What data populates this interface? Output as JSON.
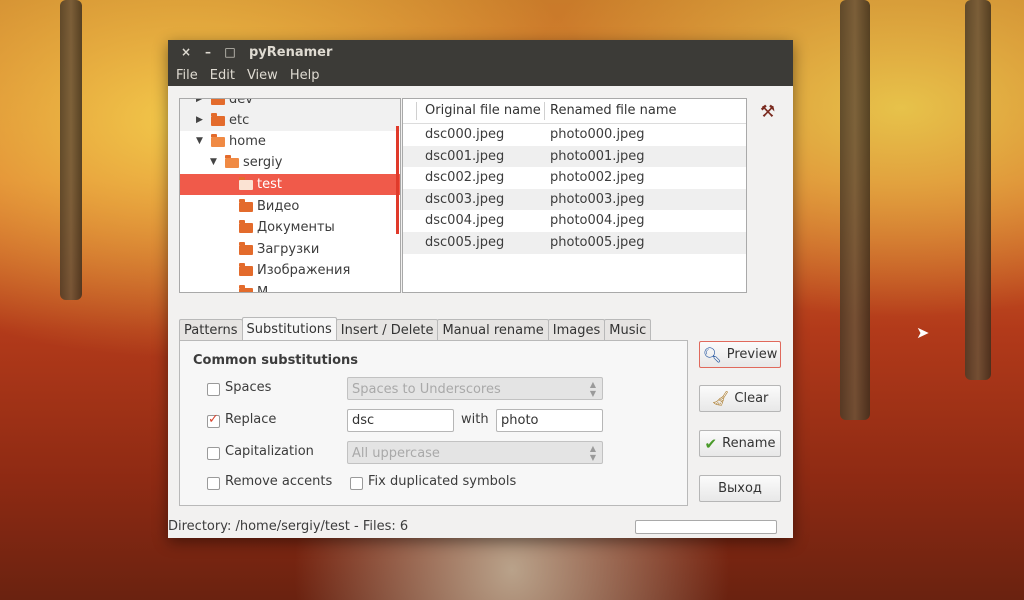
{
  "window": {
    "title": "pyRenamer"
  },
  "titlebar": {
    "close": "×",
    "minimize": "–",
    "maximize": "□"
  },
  "menu": [
    "File",
    "Edit",
    "View",
    "Help"
  ],
  "tree": [
    {
      "label": "dev",
      "indent": 0,
      "expanded": false
    },
    {
      "label": "etc",
      "indent": 0,
      "expanded": false
    },
    {
      "label": "home",
      "indent": 0,
      "expanded": true
    },
    {
      "label": "sergiy",
      "indent": 1,
      "expanded": true
    },
    {
      "label": "test",
      "indent": 2,
      "selected": true
    },
    {
      "label": "Видео",
      "indent": 2
    },
    {
      "label": "Документы",
      "indent": 2
    },
    {
      "label": "Загрузки",
      "indent": 2
    },
    {
      "label": "Изображения",
      "indent": 2
    },
    {
      "label": "М",
      "indent": 2
    }
  ],
  "files": {
    "headers": [
      "Original file name",
      "Renamed file name"
    ],
    "rows": [
      [
        "dsc000.jpeg",
        "photo000.jpeg"
      ],
      [
        "dsc001.jpeg",
        "photo001.jpeg"
      ],
      [
        "dsc002.jpeg",
        "photo002.jpeg"
      ],
      [
        "dsc003.jpeg",
        "photo003.jpeg"
      ],
      [
        "dsc004.jpeg",
        "photo004.jpeg"
      ],
      [
        "dsc005.jpeg",
        "photo005.jpeg"
      ]
    ]
  },
  "tabs": [
    "Patterns",
    "Substitutions",
    "Insert / Delete",
    "Manual rename",
    "Images",
    "Music"
  ],
  "active_tab": "Substitutions",
  "substitutions": {
    "title": "Common substitutions",
    "spaces": {
      "label": "Spaces",
      "checked": false,
      "value": "Spaces to Underscores"
    },
    "replace": {
      "label": "Replace",
      "checked": true,
      "from": "dsc",
      "with_label": "with",
      "to": "photo"
    },
    "capitalization": {
      "label": "Capitalization",
      "checked": false,
      "value": "All uppercase"
    },
    "remove_accents": {
      "label": "Remove accents",
      "checked": false
    },
    "fix_duplicated": {
      "label": "Fix duplicated symbols",
      "checked": false
    }
  },
  "buttons": {
    "preview": "Preview",
    "clear": "Clear",
    "rename": "Rename",
    "exit": "Выход"
  },
  "icons": {
    "tool": "wrench-screwdriver-icon",
    "preview": "magnifier-icon",
    "clear": "broom-icon",
    "rename": "checkmark-icon"
  },
  "status": {
    "text": "Directory: /home/sergiy/test - Files: 6",
    "progress": 0
  },
  "colors": {
    "accent": "#f05a4a",
    "titlebar": "#3c3b37",
    "window_bg": "#f2f1f0"
  }
}
